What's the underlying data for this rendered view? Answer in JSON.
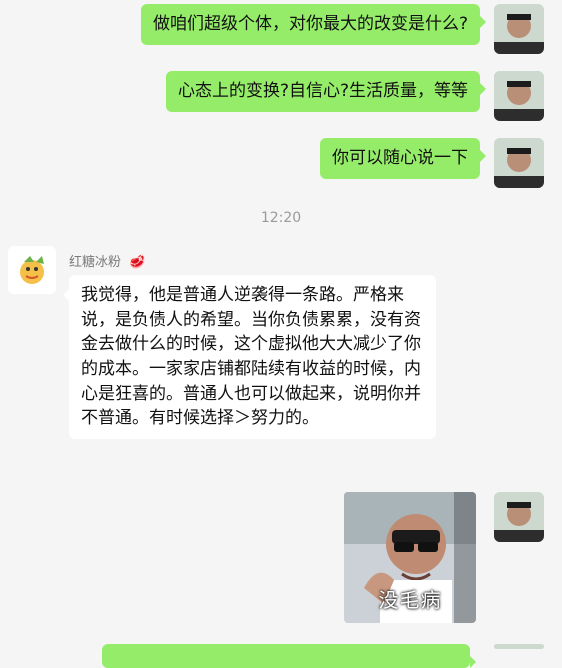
{
  "messages": [
    {
      "id": "m1",
      "side": "right",
      "text": "做咱们超级个体，对你最大的改变是什么?",
      "avatar": "user-avatar"
    },
    {
      "id": "m2",
      "side": "right",
      "text": "心态上的变换?自信心?生活质量，等等",
      "avatar": "user-avatar"
    },
    {
      "id": "m3",
      "side": "right",
      "text": "你可以随心说一下",
      "avatar": "user-avatar"
    }
  ],
  "timestamp": "12:20",
  "incoming": {
    "sender_name": "红糖冰粉",
    "sender_badge": "🥩",
    "text": "我觉得，他是普通人逆袭得一条路。严格来说，是负债人的希望。当你负债累累，没有资金去做什么的时候，这个虚拟他大大减少了你的成本。一家家店铺都陆续有收益的时候，内心是狂喜的。普通人也可以做起来，说明你并不普通。有时候选择＞努力的。"
  },
  "sticker": {
    "caption": "没毛病"
  },
  "colors": {
    "bubble_out": "#95ec69",
    "bubble_in": "#ffffff",
    "background": "#f5f5f5"
  }
}
